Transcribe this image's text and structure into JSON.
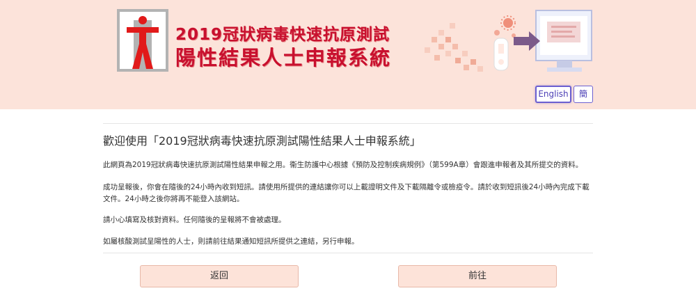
{
  "header": {
    "title_line1": "2019冠狀病毒快速抗原測試",
    "title_line2": "陽性結果人士申報系統",
    "language": {
      "english_label": "English",
      "chinese_label": "簡"
    }
  },
  "main": {
    "welcome": "歡迎使用「2019冠狀病毒快速抗原測試陽性結果人士申報系統」",
    "paragraphs": [
      "此網頁為2019冠狀病毒快速抗原測試陽性結果申報之用。衞生防護中心根據《預防及控制疾病規例》（第599A章）會跟進申報者及其所提交的資料。",
      "成功呈報後，你會在隨後的24小時內收到短訊。請使用所提供的連結讓你可以上載證明文件及下載隔離令或檢疫令。請於收到短訊後24小時內完成下載文件。24小時之後你將再不能登入該網站。",
      "請小心填寫及核對資料。任何隨後的呈報將不會被處理。",
      "如屬核酸測試呈陽性的人士，則請前往結果通知短訊所提供之連結，另行申報。"
    ]
  },
  "buttons": {
    "back_label": "返回",
    "next_label": "前往"
  },
  "colors": {
    "header_bg": "#fce3da",
    "title_red": "#c8102e",
    "button_bg": "#fde3d9",
    "accent_purple": "#6b5fd0"
  }
}
